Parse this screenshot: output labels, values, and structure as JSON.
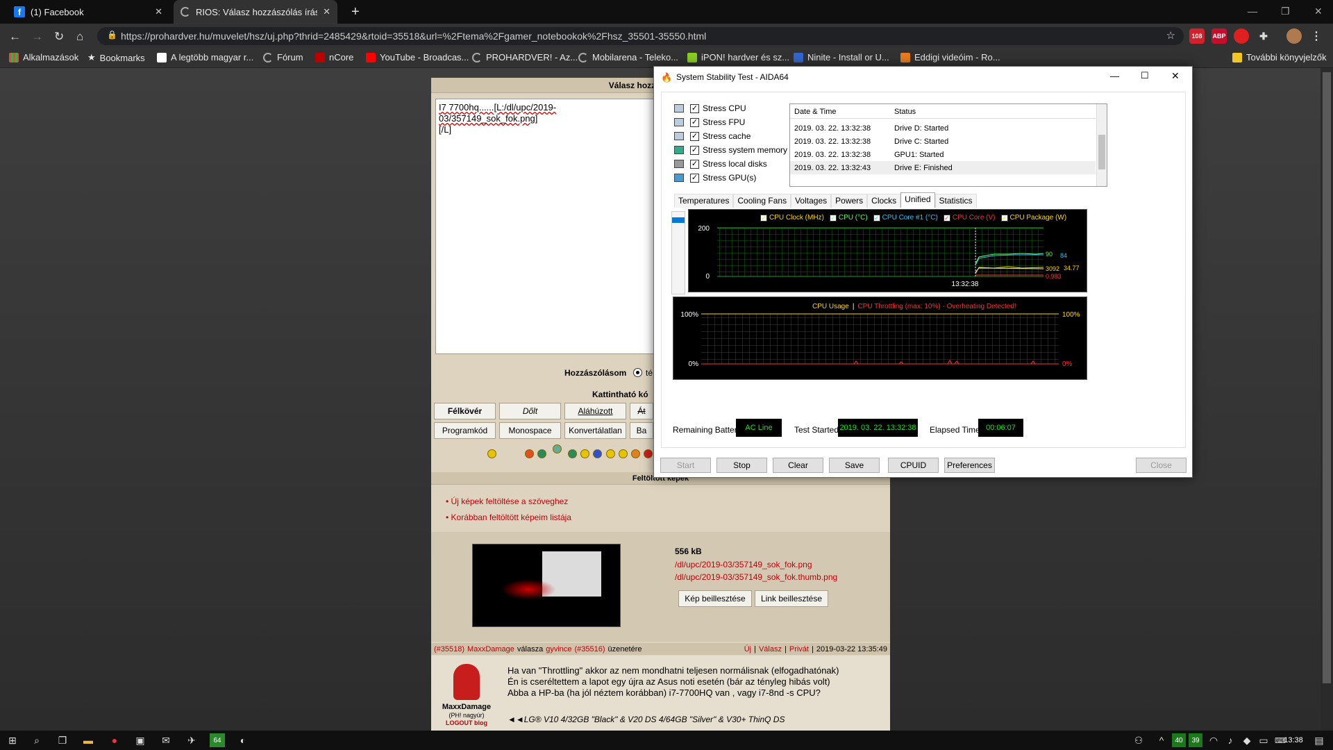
{
  "browser": {
    "tabs": [
      {
        "title": "(1) Facebook"
      },
      {
        "title": "RIOS: Válasz hozzászólás írása - T"
      }
    ],
    "url": "https://prohardver.hu/muvelet/hsz/uj.php?thrid=2485429&rtoid=35518&url=%2Ftema%2Fgamer_notebookok%2Fhsz_35501-35550.html",
    "ext_badge": "108",
    "ext_abp": "ABP",
    "bookmarks": [
      "Alkalmazások",
      "Bookmarks",
      "A legtöbb magyar r...",
      "Fórum",
      "nCore",
      "YouTube - Broadcas...",
      "PROHARDVER! - Az...",
      "Mobilarena - Teleko...",
      "iPON! hardver és sz...",
      "Ninite - Install or U...",
      "Eddigi videóim - Ro..."
    ],
    "bookmarks_more": "További könyvjelzők"
  },
  "forum": {
    "reply_header": "Válasz hozzászólás írása -",
    "textarea_text": "I7 7700hq......[L:/dl/upc/2019-03/357149_sok_fok.png]",
    "textarea_text2": "[/L]",
    "post_label": "Hozzászólásom",
    "post_radio_text": "té",
    "clickable_label": "Kattintható kó",
    "fmt_row1": [
      "Félkövér",
      "Dőlt",
      "Aláhúzott",
      "Át"
    ],
    "fmt_row2": [
      "Programkód",
      "Monospace",
      "Konvertálatlan",
      "Ba"
    ],
    "uploaded_header": "Feltöltött képek",
    "upload_links": [
      "Új képek feltöltése a szöveghez",
      "Korábban feltöltött képeim listája"
    ],
    "file_size": "556 kB",
    "file_path": "/dl/upc/2019-03/357149_sok_fok.png",
    "file_thumb": "/dl/upc/2019-03/357149_sok_fok.thumb.png",
    "insert_image": "Kép beillesztése",
    "insert_link": "Link beillesztése",
    "quote_meta": {
      "msg_id": "(#35518)",
      "author": "MaxxDamage",
      "reply_word": "válasza",
      "to_user": "gyvince",
      "to_id": "(#35516)",
      "suffix": "üzenetére",
      "new": "Új",
      "reply": "Válasz",
      "private": "Privát",
      "timestamp": "2019-03-22 13:35:49"
    },
    "quote_user": "MaxxDamage",
    "quote_rank": "(PH! nagyúr)",
    "quote_logout": "LOGOUT blog",
    "quote_lines": [
      "Ha van \"Throttling\" akkor az nem mondhatni teljesen normálisnak (elfogadhatónak)",
      "Én is cseréltettem a lapot egy újra az Asus noti esetén (bár az tényleg hibás volt)",
      "Abba a HP-ba (ha jól néztem korábban) i7-7700HQ van , vagy i7-8nd -s CPU?"
    ],
    "quote_sig": "◄◄LG® V10 4/32GB \"Black\" & V20 DS 4/64GB \"Silver\" & V30+ ThinQ DS"
  },
  "aida": {
    "title": "System Stability Test - AIDA64",
    "stress": [
      "Stress CPU",
      "Stress FPU",
      "Stress cache",
      "Stress system memory",
      "Stress local disks",
      "Stress GPU(s)"
    ],
    "log_headers": [
      "Date & Time",
      "Status"
    ],
    "log_rows": [
      [
        "2019. 03. 22. 13:32:38",
        "Drive D: Started"
      ],
      [
        "2019. 03. 22. 13:32:38",
        "Drive C: Started"
      ],
      [
        "2019. 03. 22. 13:32:38",
        "GPU1: Started"
      ],
      [
        "2019. 03. 22. 13:32:43",
        "Drive E: Finished"
      ]
    ],
    "tabs": [
      "Temperatures",
      "Cooling Fans",
      "Voltages",
      "Powers",
      "Clocks",
      "Unified",
      "Statistics"
    ],
    "legend": [
      "CPU Clock (MHz)",
      "CPU (°C)",
      "CPU Core #1 (°C)",
      "CPU Core (V)",
      "CPU Package (W)"
    ],
    "legend_colors": [
      "#ffd700",
      "#60ff60",
      "#20c8ff",
      "#ff3030",
      "#ffd700"
    ],
    "graph1_ymax": "200",
    "graph1_ymin": "0",
    "graph1_time": "13:32:38",
    "graph1_vals": [
      "90",
      "84",
      "3092",
      "34.77",
      "0.983"
    ],
    "usage_title": "CPU Usage",
    "usage_sep": "|",
    "usage_throttle": "CPU Throttling (max: 10%) - Overheating Detected!",
    "usage_100": "100%",
    "usage_0": "0%",
    "battery_label": "Remaining Battery:",
    "battery": "AC Line",
    "started_label": "Test Started:",
    "started": "2019. 03. 22. 13:32:38",
    "elapsed_label": "Elapsed Time:",
    "elapsed": "00:06:07",
    "buttons": [
      "Start",
      "Stop",
      "Clear",
      "Save",
      "CPUID",
      "Preferences",
      "Close"
    ]
  },
  "taskbar": {
    "time": "13:38",
    "badge1": "40",
    "badge2": "39",
    "app64": "64"
  },
  "chart_data": [
    {
      "type": "line",
      "title": "",
      "series": [
        {
          "name": "CPU (°C)",
          "values": [
            90
          ]
        },
        {
          "name": "CPU Core #1 (°C)",
          "values": [
            84
          ]
        },
        {
          "name": "CPU Clock (MHz)",
          "values": [
            3092
          ]
        },
        {
          "name": "CPU Package (W)",
          "values": [
            34.77
          ]
        },
        {
          "name": "CPU Core (V)",
          "values": [
            0.983
          ]
        }
      ],
      "ylim": [
        0,
        200
      ],
      "x": [
        "13:32:38"
      ]
    },
    {
      "type": "line",
      "title": "CPU Usage",
      "ylim": [
        0,
        100
      ],
      "series": [
        {
          "name": "CPU Usage",
          "values": [
            100
          ]
        }
      ]
    }
  ]
}
